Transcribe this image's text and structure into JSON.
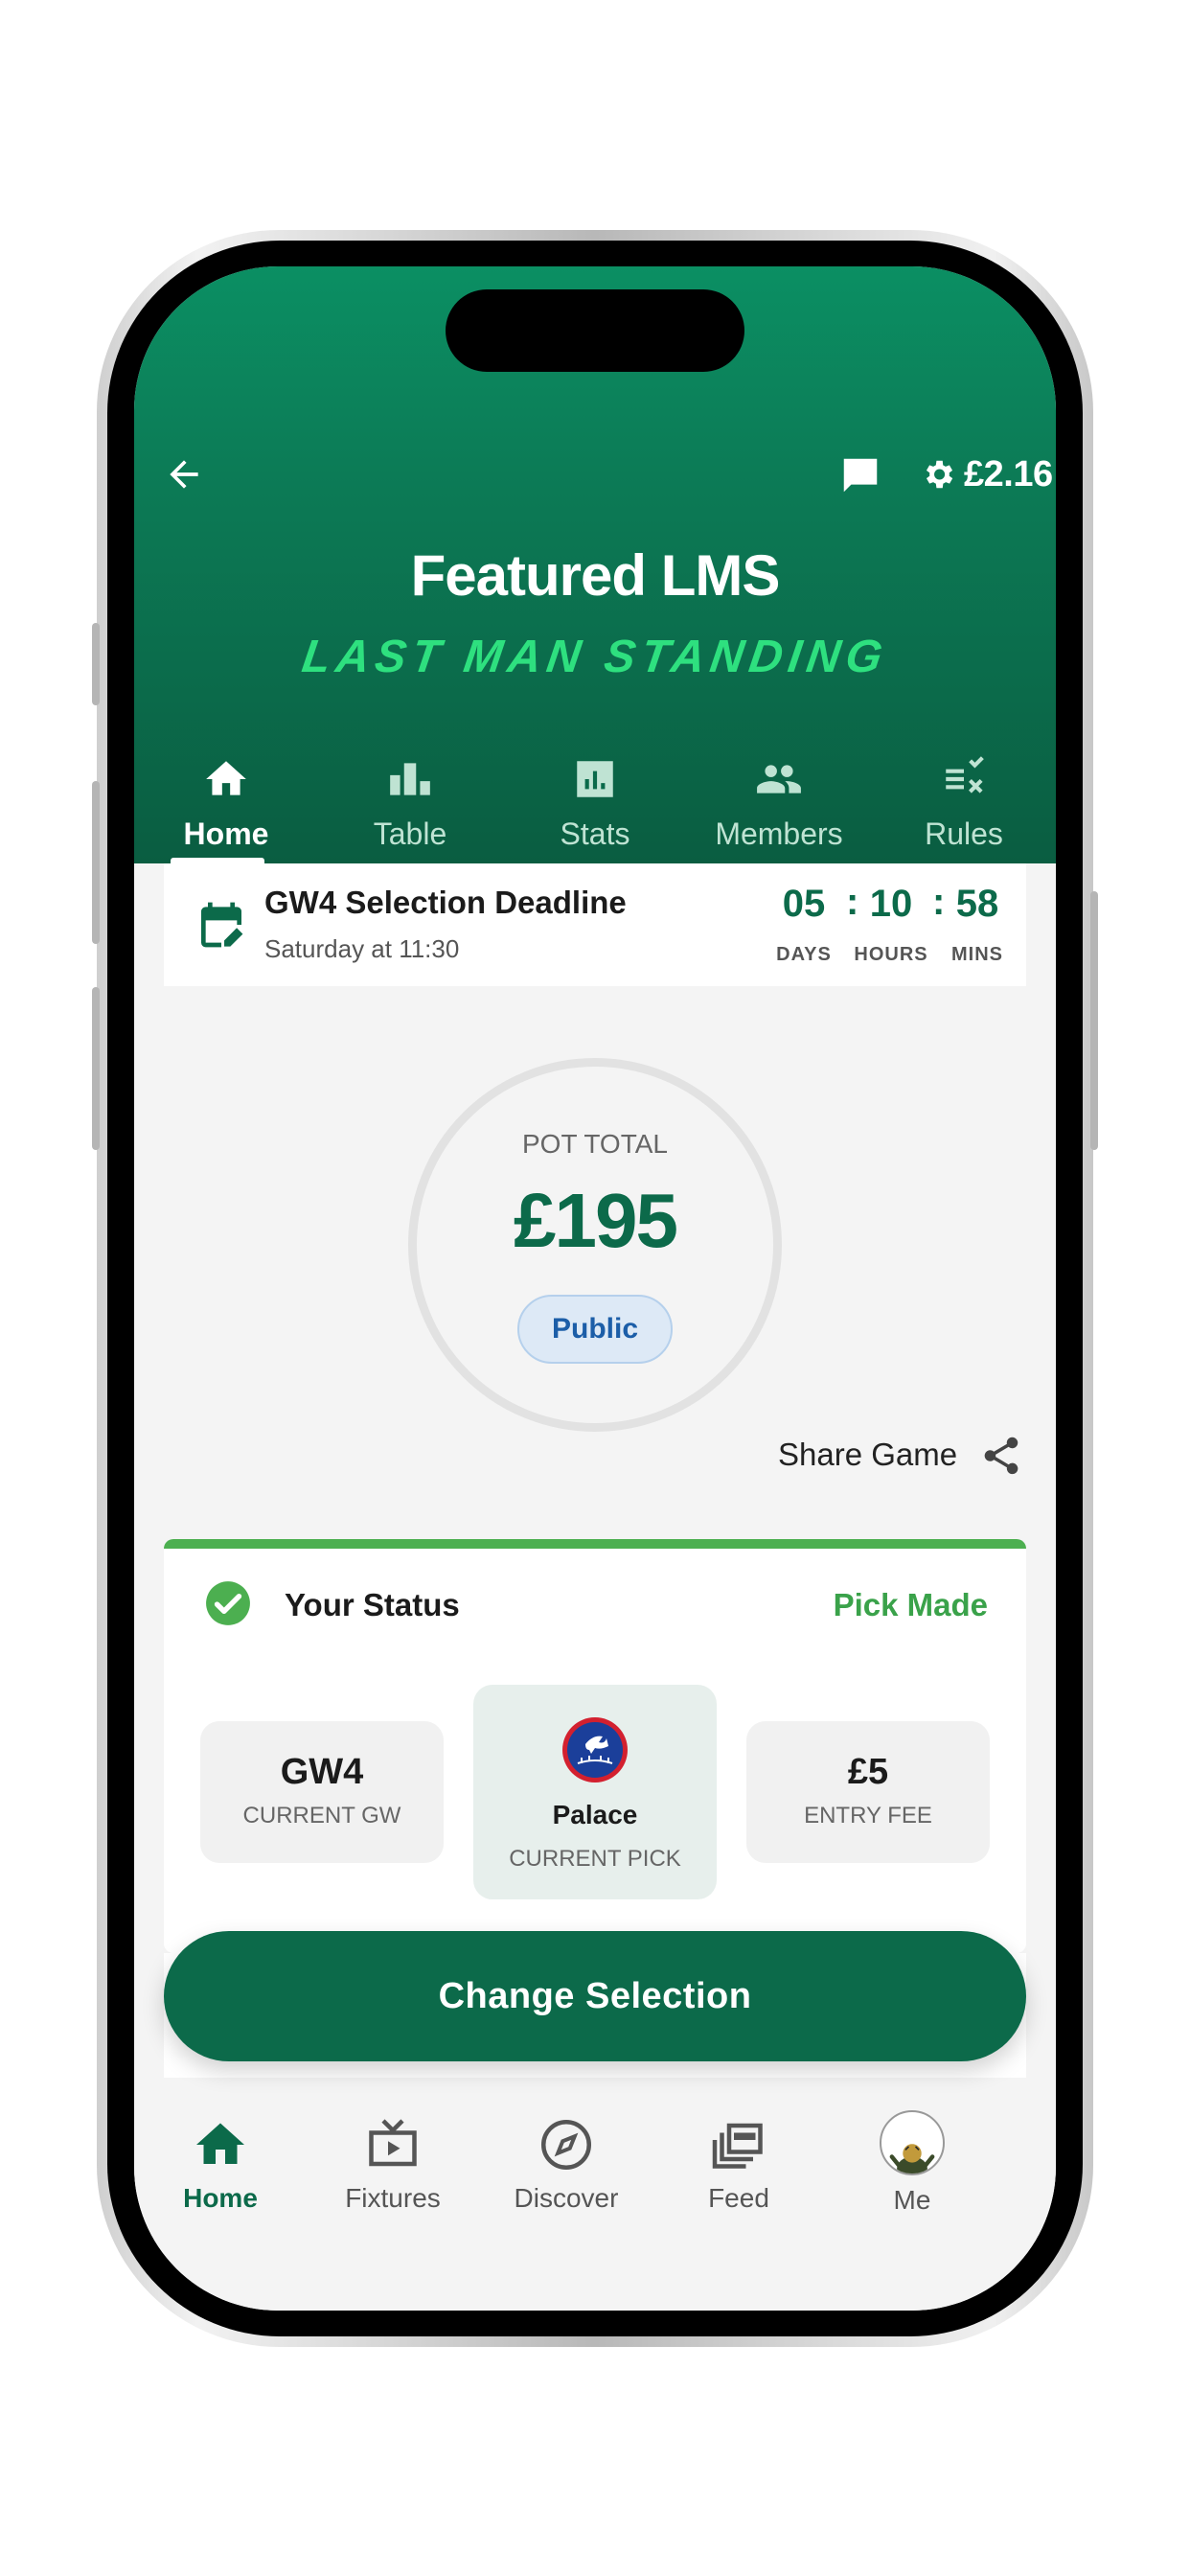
{
  "header": {
    "balance": "£2.16",
    "title": "Featured LMS",
    "subtitle": "LAST MAN STANDING",
    "tabs": [
      {
        "label": "Home",
        "icon": "home-icon",
        "active": true
      },
      {
        "label": "Table",
        "icon": "bar-chart-icon"
      },
      {
        "label": "Stats",
        "icon": "stats-icon"
      },
      {
        "label": "Members",
        "icon": "members-icon"
      },
      {
        "label": "Rules",
        "icon": "rules-icon"
      }
    ]
  },
  "deadline": {
    "title": "GW4 Selection Deadline",
    "subtitle": "Saturday at 11:30",
    "days": "05",
    "hours": "10",
    "mins": "58",
    "separator": ":",
    "days_label": "DAYS",
    "hours_label": "HOURS",
    "mins_label": "MINS"
  },
  "pot": {
    "label": "POT TOTAL",
    "amount": "£195",
    "visibility": "Public"
  },
  "share": {
    "label": "Share Game"
  },
  "status": {
    "title": "Your Status",
    "value": "Pick Made",
    "current_gw": {
      "value": "GW4",
      "label": "CURRENT GW"
    },
    "current_pick": {
      "value": "Palace",
      "label": "CURRENT PICK",
      "icon": "crystal-palace-crest-icon"
    },
    "entry_fee": {
      "value": "£5",
      "label": "ENTRY FEE"
    }
  },
  "cta": {
    "label": "Change Selection"
  },
  "bottom_nav": [
    {
      "label": "Home",
      "icon": "home-icon",
      "active": true
    },
    {
      "label": "Fixtures",
      "icon": "tv-icon"
    },
    {
      "label": "Discover",
      "icon": "compass-icon"
    },
    {
      "label": "Feed",
      "icon": "feed-icon"
    },
    {
      "label": "Me",
      "icon": "avatar"
    }
  ],
  "colors": {
    "brand_green": "#0c6a4a",
    "accent_green": "#2ee07f",
    "status_green": "#3aa24a",
    "public_blue": "#1c5ea8"
  }
}
